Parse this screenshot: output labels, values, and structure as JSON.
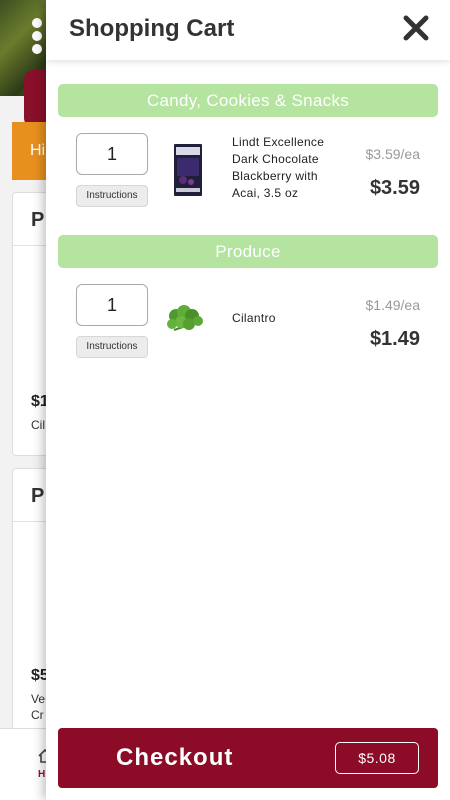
{
  "background": {
    "banner_text": "Hi",
    "card1": {
      "title": "P",
      "price": "$1",
      "name": "Cil"
    },
    "card2": {
      "title": "P",
      "price": "$5",
      "name_line1": "Ve",
      "name_line2": "Cr"
    },
    "nav_label": "H"
  },
  "cart": {
    "title": "Shopping Cart",
    "close_icon": "close-icon",
    "sections": [
      {
        "name": "Candy, Cookies & Snacks",
        "items": [
          {
            "qty": "1",
            "instructions_label": "Instructions",
            "name": "Lindt Excellence Dark Chocolate Blackberry with Acai, 3.5 oz",
            "unit_price": "$3.59/ea",
            "total": "$3.59"
          }
        ]
      },
      {
        "name": "Produce",
        "items": [
          {
            "qty": "1",
            "instructions_label": "Instructions",
            "name": "Cilantro",
            "unit_price": "$1.49/ea",
            "total": "$1.49"
          }
        ]
      }
    ],
    "checkout": {
      "label": "Checkout",
      "total": "$5.08"
    }
  },
  "colors": {
    "brand_maroon": "#8c0b26",
    "section_green": "#b5e3a0",
    "orange": "#e8901e"
  }
}
